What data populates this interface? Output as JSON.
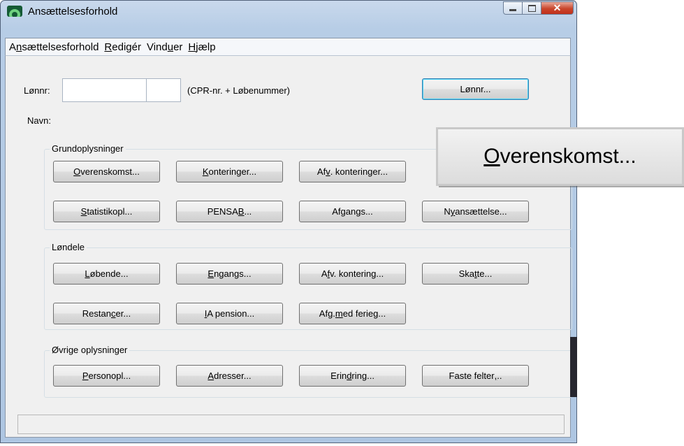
{
  "window": {
    "title": "Ansættelsesforhold"
  },
  "menu": [
    {
      "pre": "A",
      "u": "n",
      "post": "sættelsesforhold"
    },
    {
      "pre": "",
      "u": "R",
      "post": "edigér"
    },
    {
      "pre": "Vind",
      "u": "u",
      "post": "er"
    },
    {
      "pre": "",
      "u": "H",
      "post": "jælp"
    }
  ],
  "form": {
    "lonnr_label": "Lønnr:",
    "lonnr_value": "",
    "lobenr_value": "",
    "hint": "(CPR-nr. + Løbenummer)",
    "lonnr_button": "Lønnr...",
    "navn_label": "Navn:"
  },
  "groups": {
    "grund": {
      "label": "Grundoplysninger",
      "buttons": [
        {
          "pre": "",
          "u": "O",
          "post": "verenskomst..."
        },
        {
          "pre": "",
          "u": "K",
          "post": "onteringer..."
        },
        {
          "pre": "Af",
          "u": "v",
          "post": ". konteringer..."
        },
        {
          "pre": "",
          "u": "S",
          "post": "tatistikopl..."
        },
        {
          "pre": "PENSA",
          "u": "B",
          "post": "..."
        },
        {
          "pre": "Af",
          "u": "g",
          "post": "angs..."
        },
        {
          "pre": "N",
          "u": "y",
          "post": "ansættelse..."
        }
      ]
    },
    "lon": {
      "label": "Løndele",
      "buttons": [
        {
          "pre": "",
          "u": "L",
          "post": "øbende..."
        },
        {
          "pre": "",
          "u": "E",
          "post": "ngangs..."
        },
        {
          "pre": "A",
          "u": "f",
          "post": "v. kontering..."
        },
        {
          "pre": "Ska",
          "u": "t",
          "post": "te..."
        },
        {
          "pre": "Restan",
          "u": "c",
          "post": "er..."
        },
        {
          "pre": "",
          "u": "I",
          "post": "A pension..."
        },
        {
          "pre": "Afg. ",
          "u": "m",
          "post": "ed ferieg..."
        }
      ]
    },
    "ovrige": {
      "label": "Øvrige oplysninger",
      "buttons": [
        {
          "pre": "",
          "u": "P",
          "post": "ersonopl..."
        },
        {
          "pre": "",
          "u": "A",
          "post": "dresser..."
        },
        {
          "pre": "Erin",
          "u": "d",
          "post": "ring..."
        },
        {
          "pre": "Faste felter",
          "u": ",",
          "post": ".."
        }
      ]
    }
  },
  "zoom_callout": {
    "pre": "",
    "u": "O",
    "post": "verenskomst..."
  }
}
